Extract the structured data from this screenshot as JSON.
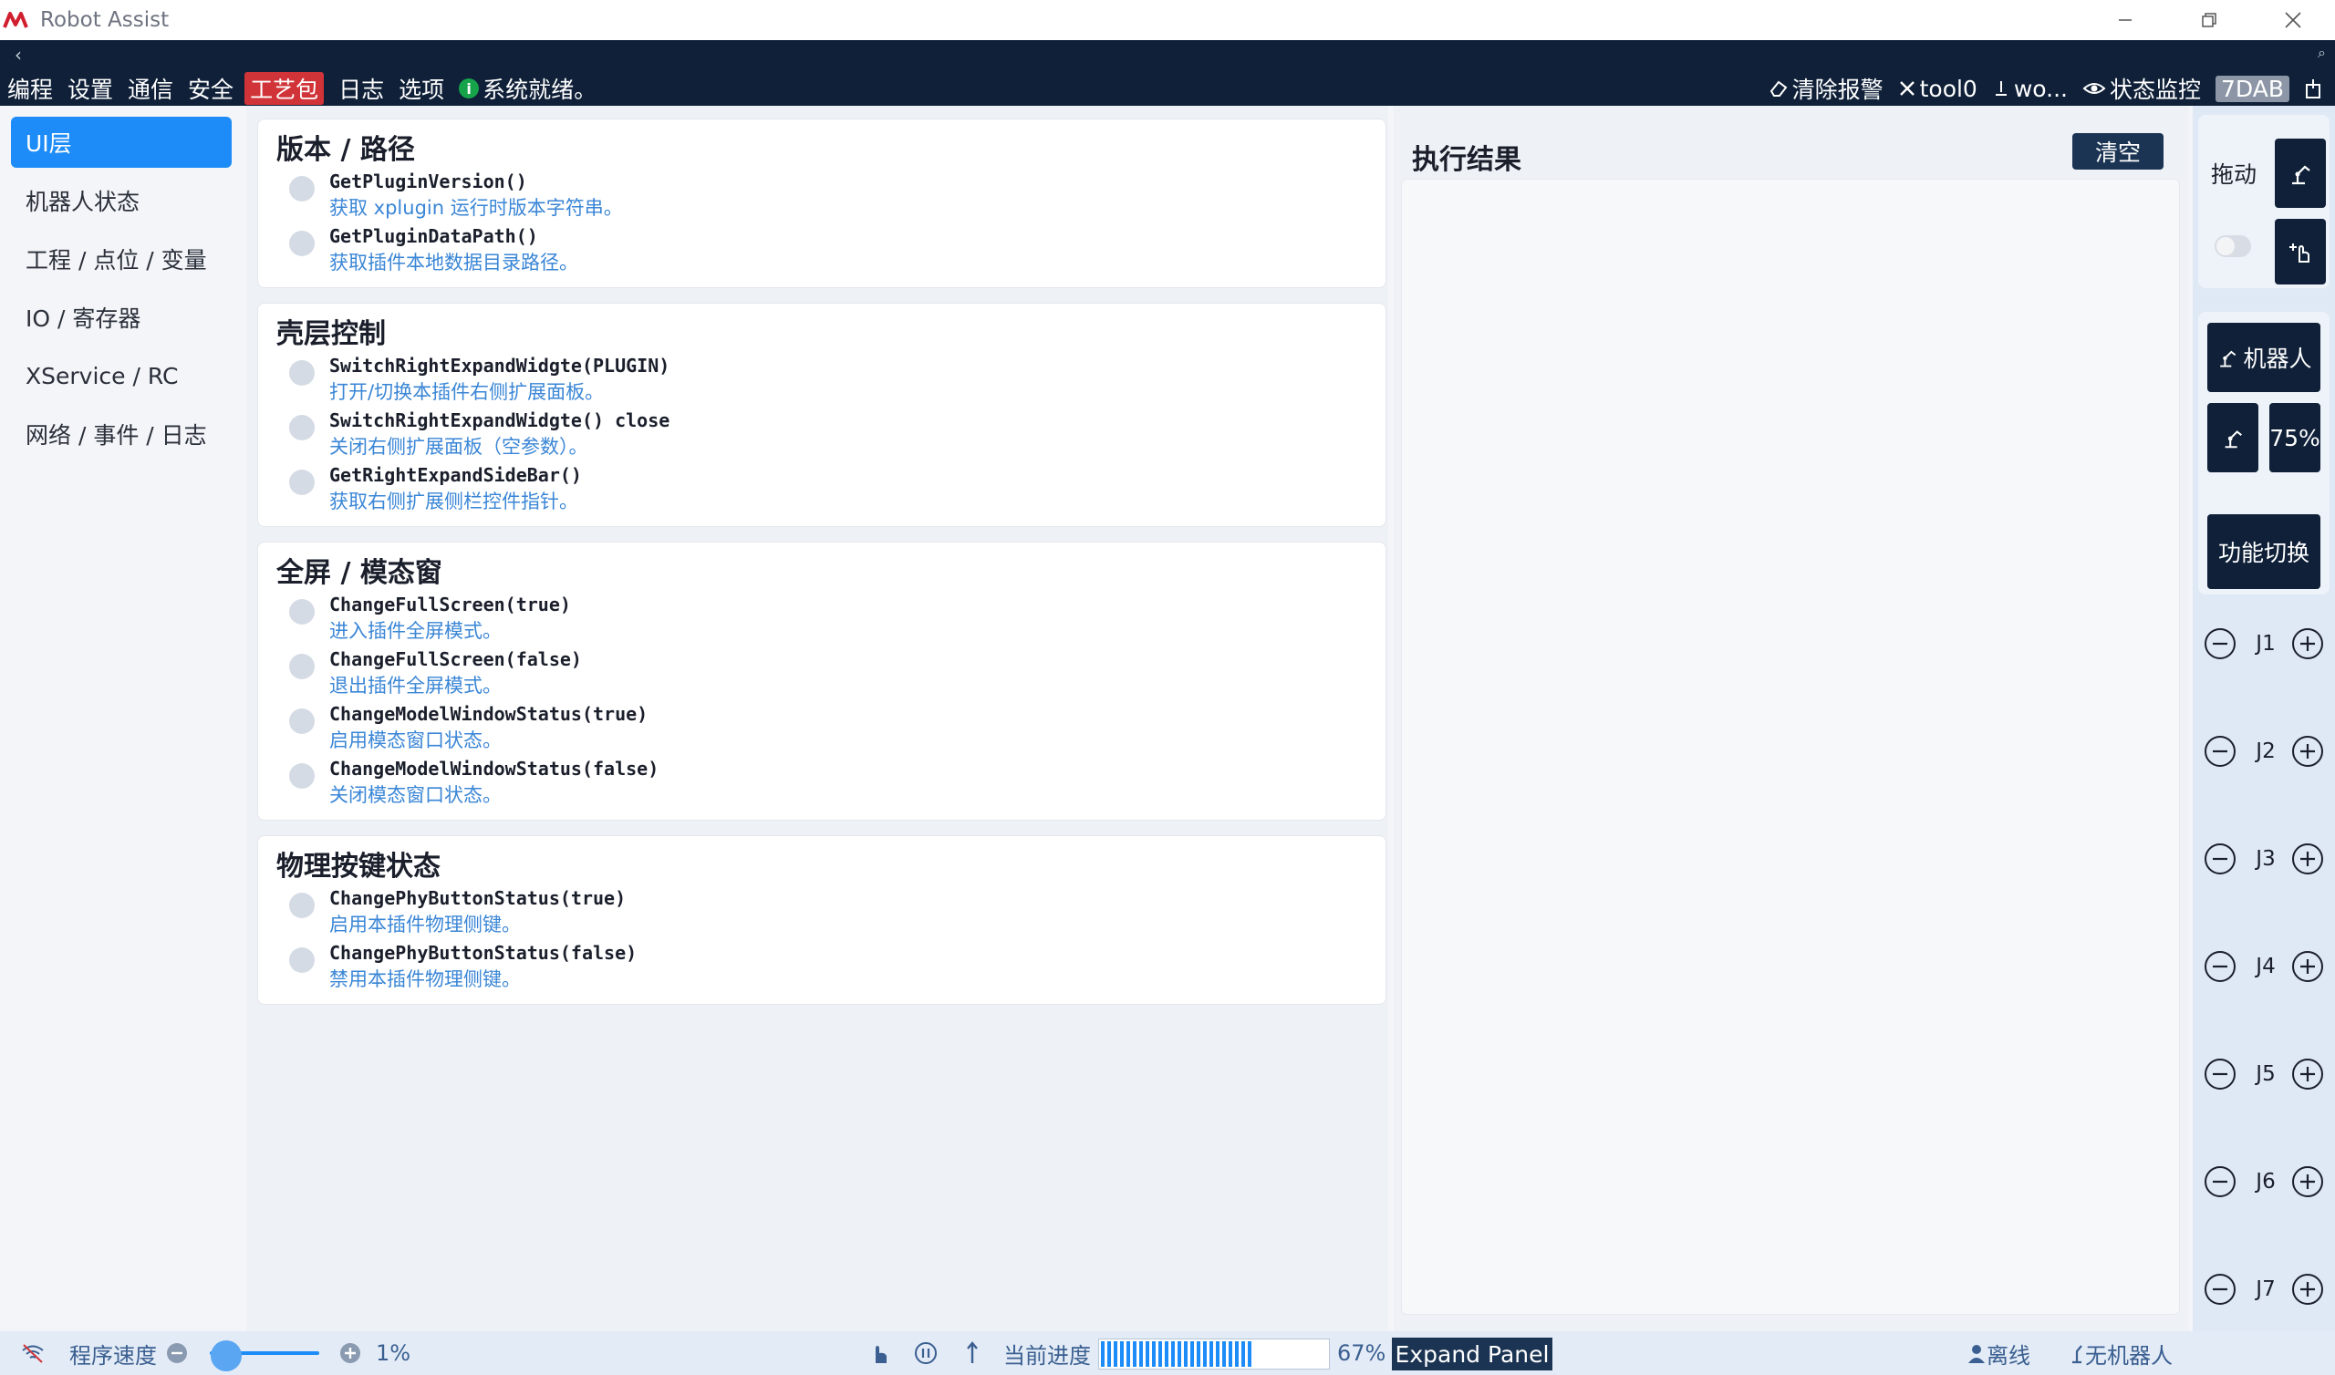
{
  "window": {
    "title": "Robot Assist"
  },
  "menu": {
    "items": [
      "编程",
      "设置",
      "通信",
      "安全",
      "工艺包",
      "日志",
      "选项"
    ],
    "active": "工艺包",
    "status": "系统就绪。",
    "right": {
      "clear_alarm": "清除报警",
      "tool": "tool0",
      "workpiece": "wo...",
      "monitor": "状态监控",
      "device": "7DAB"
    }
  },
  "sidebar": {
    "items": [
      {
        "label": "UI层",
        "active": true
      },
      {
        "label": "机器人状态"
      },
      {
        "label": "工程 / 点位 / 变量"
      },
      {
        "label": "IO / 寄存器"
      },
      {
        "label": "XService / RC"
      },
      {
        "label": "网络 / 事件 / 日志"
      }
    ]
  },
  "sections": [
    {
      "title": "版本 / 路径",
      "items": [
        {
          "fn": "GetPluginVersion()",
          "desc": "获取 xplugin 运行时版本字符串。"
        },
        {
          "fn": "GetPluginDataPath()",
          "desc": "获取插件本地数据目录路径。"
        }
      ]
    },
    {
      "title": "壳层控制",
      "items": [
        {
          "fn": "SwitchRightExpandWidgte(PLUGIN)",
          "desc": "打开/切换本插件右侧扩展面板。"
        },
        {
          "fn": "SwitchRightExpandWidgte() close",
          "desc": "关闭右侧扩展面板（空参数）。"
        },
        {
          "fn": "GetRightExpandSideBar()",
          "desc": "获取右侧扩展侧栏控件指针。"
        }
      ]
    },
    {
      "title": "全屏 / 模态窗",
      "items": [
        {
          "fn": "ChangeFullScreen(true)",
          "desc": "进入插件全屏模式。"
        },
        {
          "fn": "ChangeFullScreen(false)",
          "desc": "退出插件全屏模式。"
        },
        {
          "fn": "ChangeModelWindowStatus(true)",
          "desc": "启用模态窗口状态。"
        },
        {
          "fn": "ChangeModelWindowStatus(false)",
          "desc": "关闭模态窗口状态。"
        }
      ]
    },
    {
      "title": "物理按键状态",
      "items": [
        {
          "fn": "ChangePhyButtonStatus(true)",
          "desc": "启用本插件物理侧键。"
        },
        {
          "fn": "ChangePhyButtonStatus(false)",
          "desc": "禁用本插件物理侧键。"
        }
      ]
    }
  ],
  "results": {
    "title": "执行结果",
    "clear": "清空"
  },
  "right_panel": {
    "drag_label": "拖动",
    "robot_button": "机器人",
    "speed": "75%",
    "func_switch": "功能切换",
    "joints": [
      "J1",
      "J2",
      "J3",
      "J4",
      "J5",
      "J6",
      "J7"
    ]
  },
  "statusbar": {
    "program_speed_label": "程序速度",
    "program_speed_value": "1%",
    "program_speed_fraction": 0.01,
    "progress_label": "当前进度",
    "progress_value": "67%",
    "progress_fraction": 0.67,
    "expand_panel": "Expand Panel",
    "offline": "离线",
    "no_robot": "无机器人"
  },
  "colors": {
    "navy": "#0f2038",
    "accent": "#1d8cf8",
    "active_menu": "#d13438",
    "status_ok": "#16a34a",
    "desc_text": "#3a86d6"
  }
}
